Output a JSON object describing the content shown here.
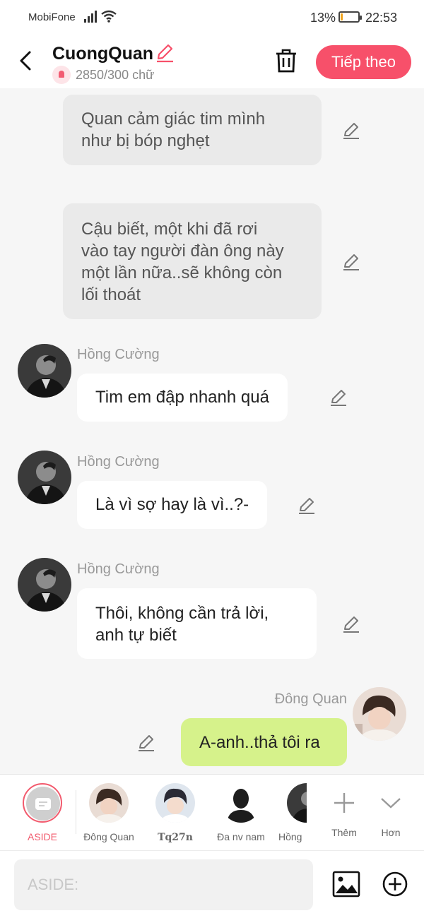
{
  "status_bar": {
    "carrier": "MobiFone",
    "battery_percent": "13%",
    "battery_level": 0.13,
    "time": "22:53"
  },
  "header": {
    "title": "CuongQuan",
    "word_count": "2850/300 chữ",
    "next_button": "Tiếp theo",
    "accent_color": "#f7506a"
  },
  "messages": [
    {
      "type": "aside",
      "text_lines": [
        "Quan cảm giác tim mình",
        "như bị bóp nghẹt"
      ]
    },
    {
      "type": "aside",
      "text_lines": [
        "Cậu biết, một khi đã rơi",
        "vào tay người đàn ông này",
        "một lần nữa..sẽ không còn",
        "lối thoát"
      ]
    },
    {
      "type": "left",
      "sender": "Hồng Cường",
      "text_lines": [
        "Tim em đập nhanh quá"
      ]
    },
    {
      "type": "left",
      "sender": "Hồng Cường",
      "text_lines": [
        "Là vì sợ hay là vì..?-"
      ]
    },
    {
      "type": "left",
      "sender": "Hồng Cường",
      "text_lines": [
        "Thôi, không cần trả lời,",
        "anh tự biết"
      ]
    },
    {
      "type": "right",
      "sender": "Đông Quan",
      "text_lines": [
        "A-anh..thả tôi ra"
      ]
    }
  ],
  "characters": {
    "aside_label": "ASIDE",
    "items": [
      {
        "name": "Đông Quan"
      },
      {
        "name": "Tq27n"
      },
      {
        "name": "Đa nv nam"
      },
      {
        "name": "Hồng"
      }
    ],
    "more_label": "Thêm",
    "expand_label": "Hơn"
  },
  "composer": {
    "placeholder": "ASIDE:"
  }
}
